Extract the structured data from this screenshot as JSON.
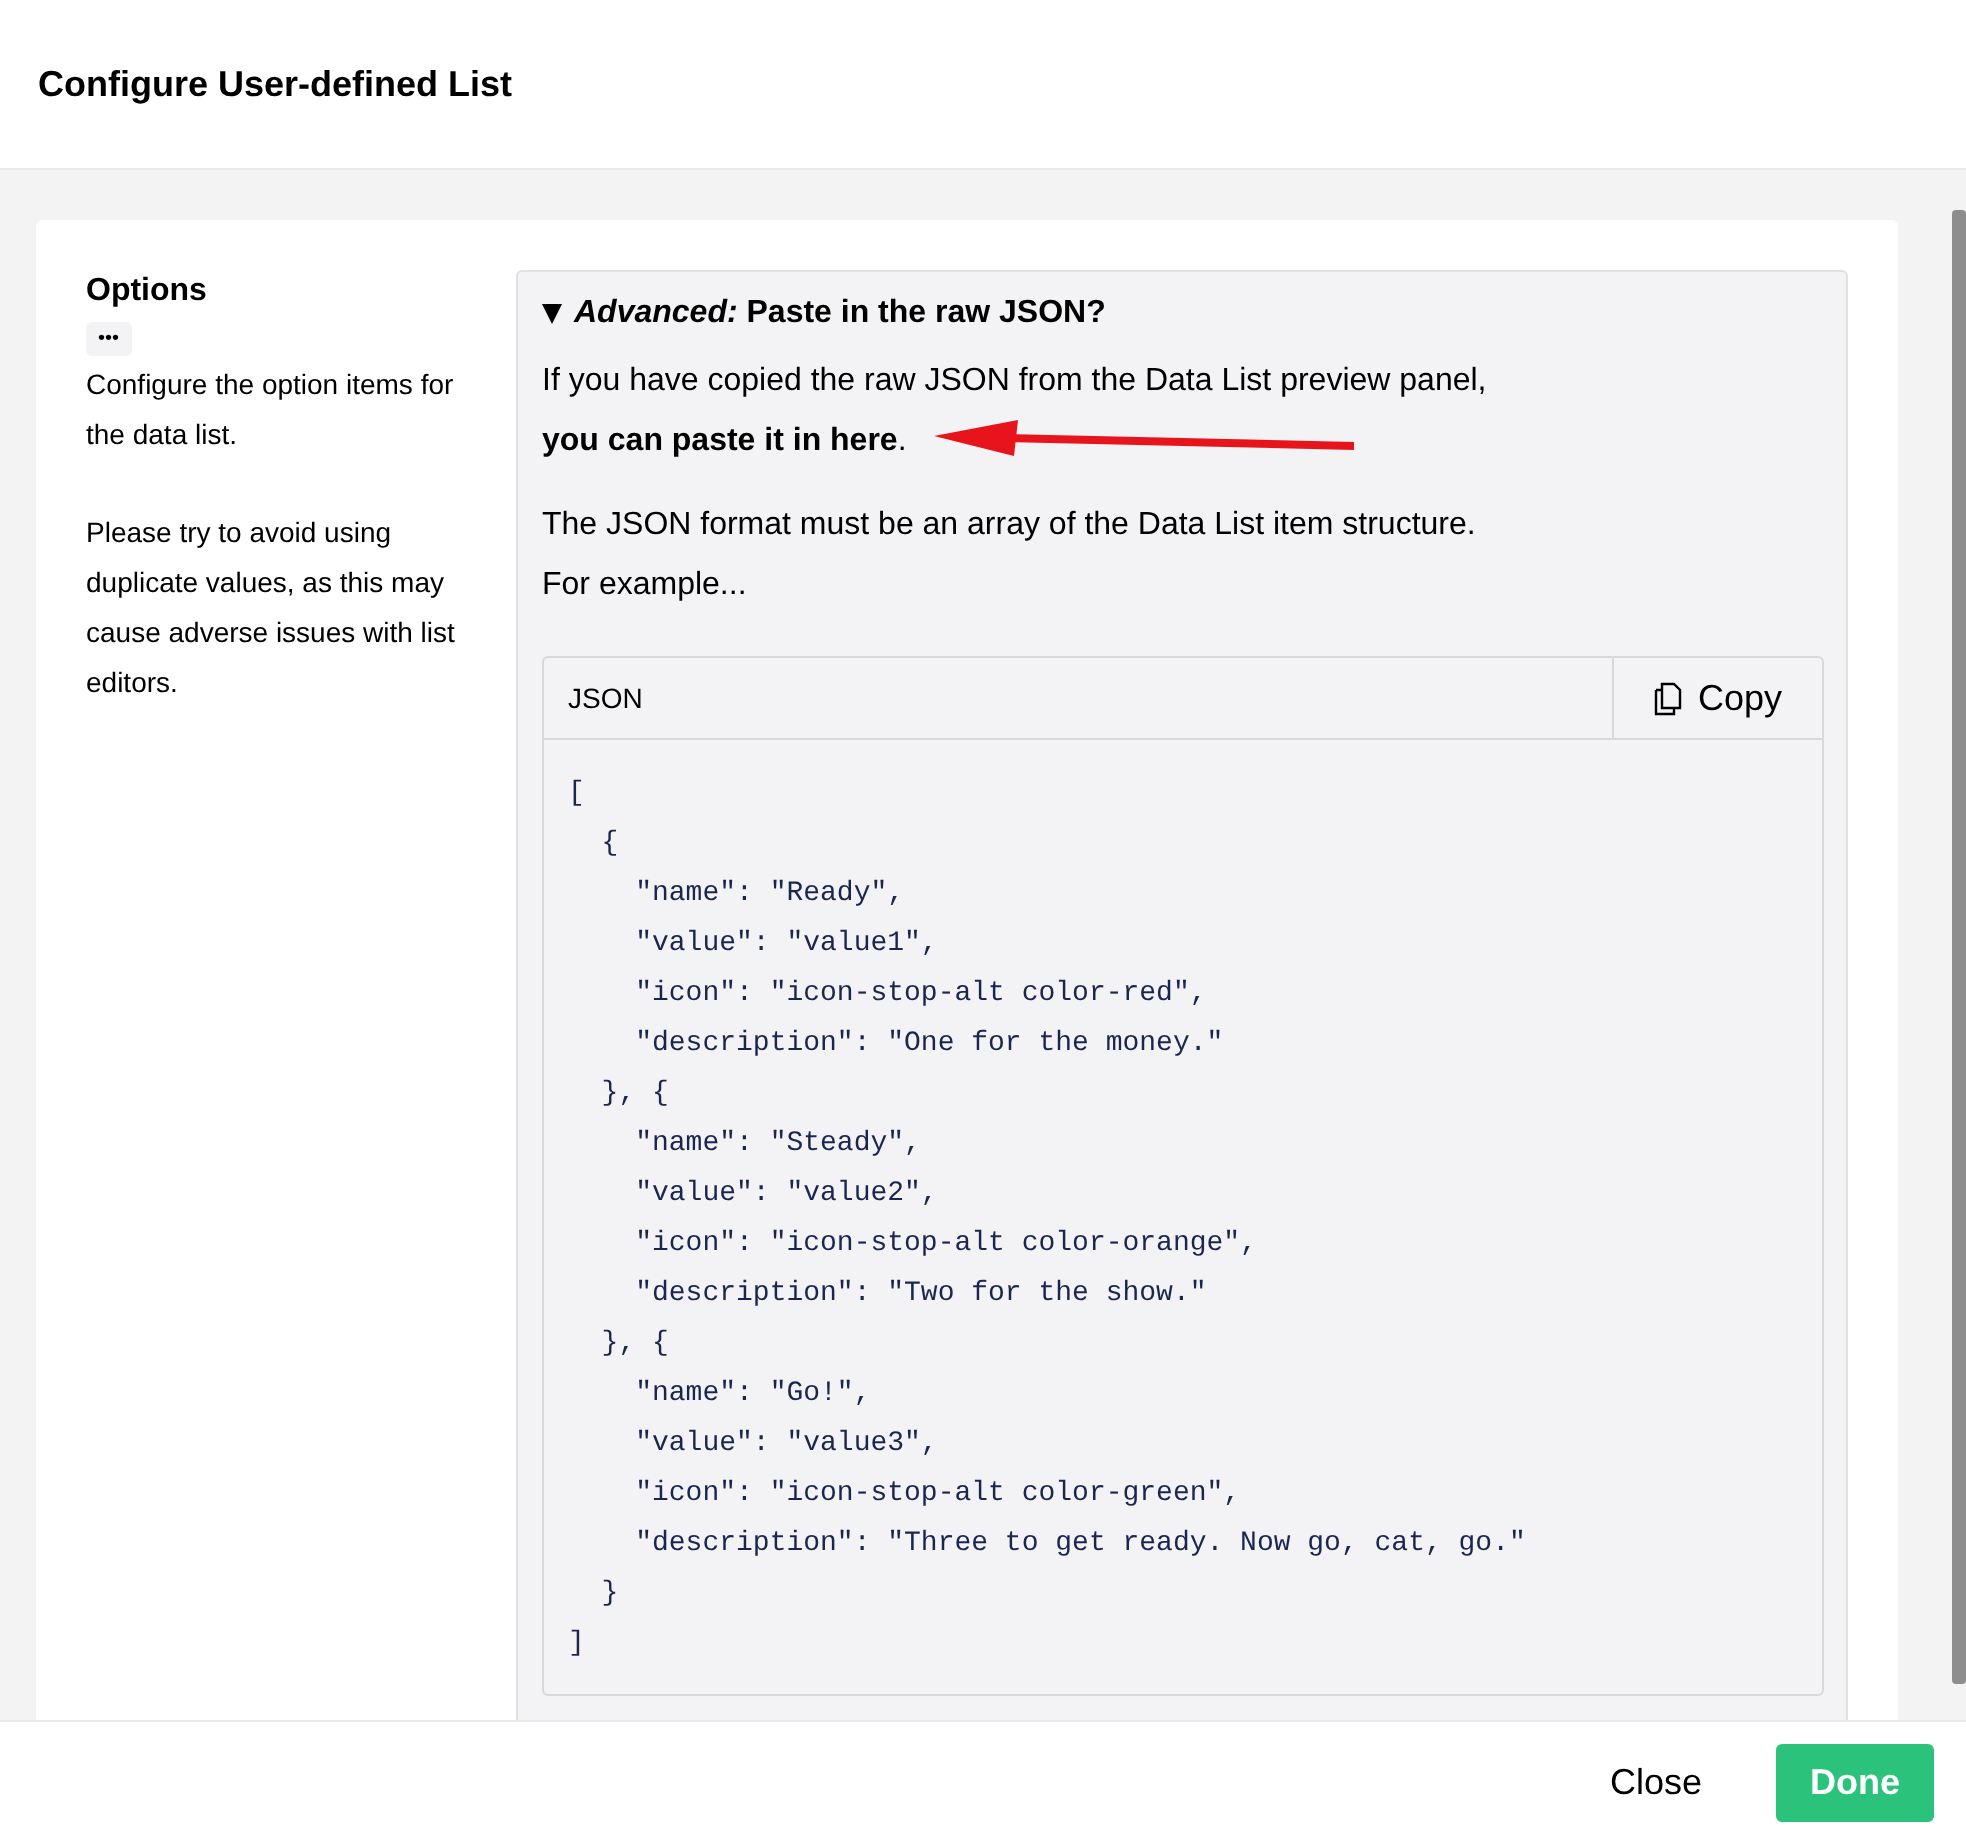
{
  "dialog": {
    "title": "Configure User-defined List"
  },
  "options": {
    "heading": "Options",
    "more_label": "•••",
    "descriptions": [
      "Configure the option items for the data list.",
      "Please try to avoid using duplicate values, as this may cause adverse issues with list editors."
    ]
  },
  "advanced": {
    "expanded": true,
    "summary": "*Advanced:* Paste in the raw JSON?",
    "intro_lines": [
      "If you have copied the raw JSON from the Data List preview panel,",
      "**you can paste it in here**."
    ],
    "paragraphs": [
      "The JSON format must be an array of the Data List item structure.\nFor example..."
    ],
    "code_block": {
      "language": "JSON",
      "copy_label": "Copy",
      "lines": [
        "[",
        "  {",
        "    \"name\": \"Ready\",",
        "    \"value\": \"value1\",",
        "    \"icon\": \"icon-stop-alt color-red\",",
        "    \"description\": \"One for the money.\"",
        "  }, {",
        "    \"name\": \"Steady\",",
        "    \"value\": \"value2\",",
        "    \"icon\": \"icon-stop-alt color-orange\",",
        "    \"description\": \"Two for the show.\"",
        "  }, {",
        "    \"name\": \"Go!\",",
        "    \"value\": \"value3\",",
        "    \"icon\": \"icon-stop-alt color-green\",",
        "    \"description\": \"Three to get ready. Now go, cat, go.\"",
        "  }",
        "]"
      ]
    }
  },
  "footer": {
    "buttons": [
      {
        "label": "Close",
        "kind": "link"
      },
      {
        "label": "Done",
        "kind": "primary"
      }
    ]
  }
}
